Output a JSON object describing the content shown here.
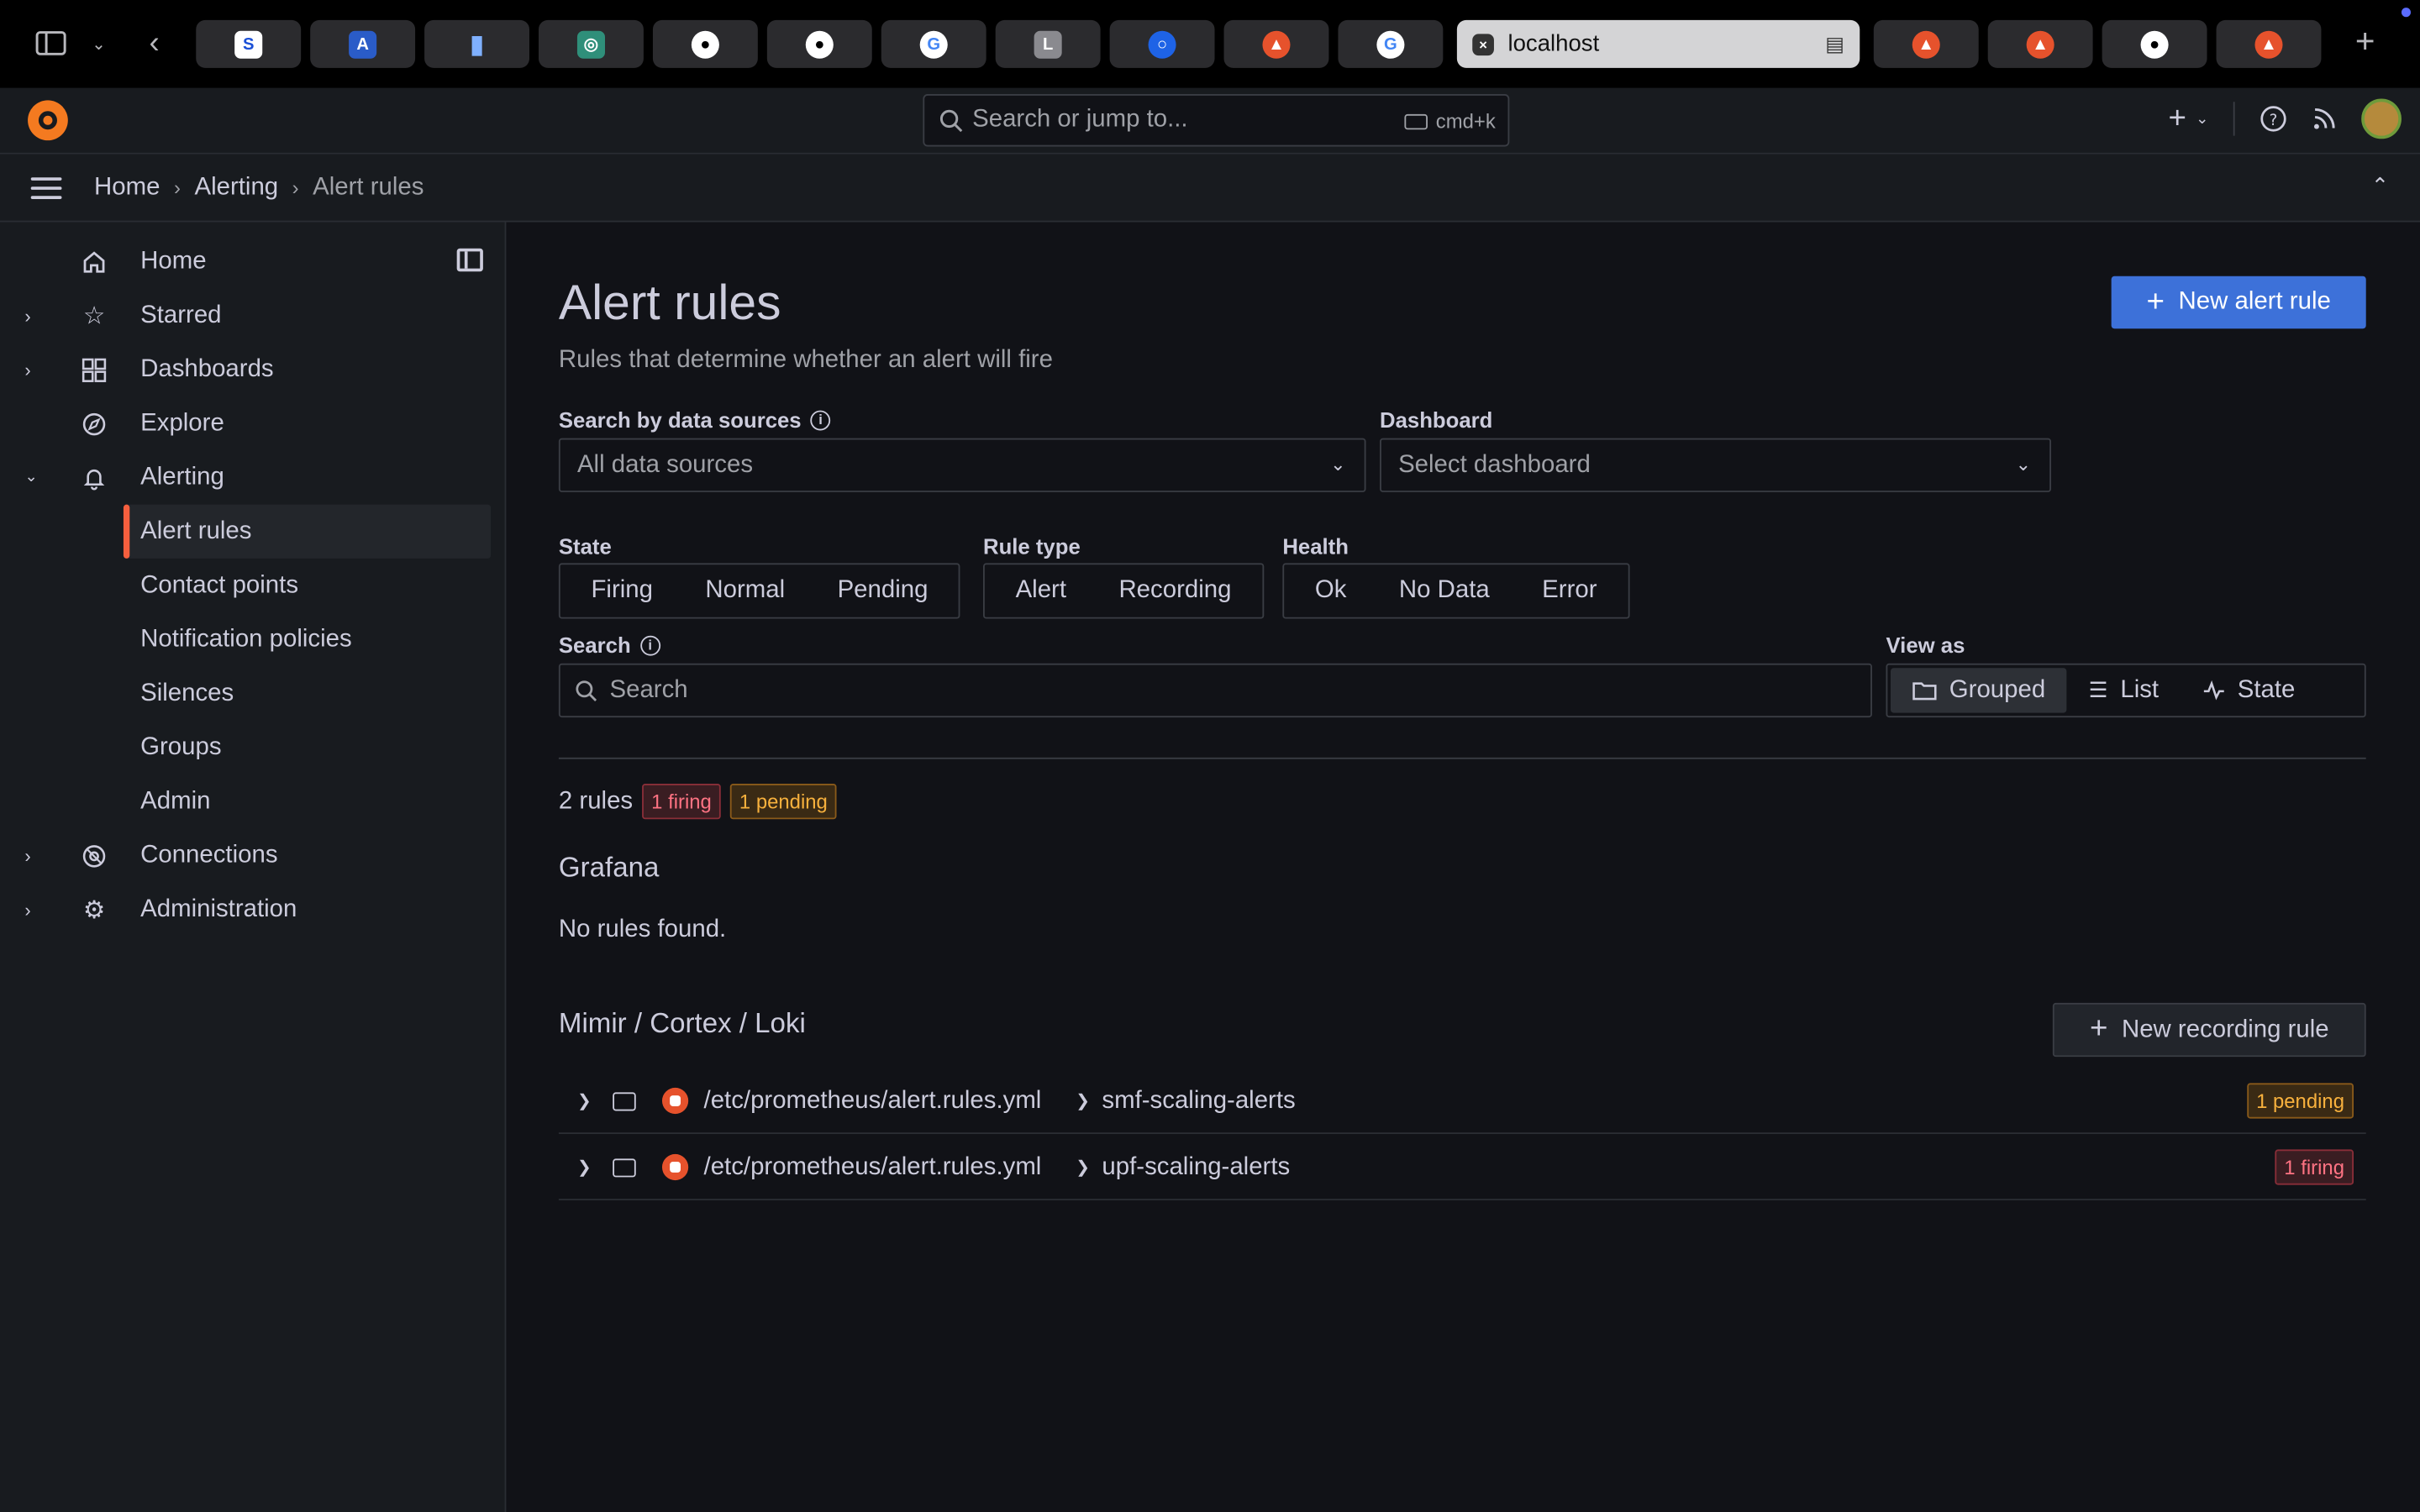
{
  "browser": {
    "active_tab_title": "localhost",
    "tab_favicons": [
      "ms-tab-icon",
      "as-tab-icon",
      "chart-tab-icon",
      "box-tab-icon",
      "github-icon",
      "github-icon",
      "google-icon",
      "l-tab-icon",
      "circle-tab-icon",
      "prometheus-icon",
      "google-icon",
      "localhost-favicon",
      "prometheus-icon",
      "prometheus-icon",
      "github-icon",
      "prometheus-icon"
    ],
    "favicon_letters": {
      "l": "L"
    }
  },
  "topbar": {
    "search_placeholder": "Search or jump to...",
    "shortcut": "cmd+k"
  },
  "breadcrumb": [
    "Home",
    "Alerting",
    "Alert rules"
  ],
  "sidebar": {
    "items": [
      {
        "label": "Home",
        "icon": "home-icon",
        "expandable": false
      },
      {
        "label": "Starred",
        "icon": "star-icon",
        "expandable": true
      },
      {
        "label": "Dashboards",
        "icon": "dashboards-icon",
        "expandable": true
      },
      {
        "label": "Explore",
        "icon": "compass-icon",
        "expandable": false
      },
      {
        "label": "Alerting",
        "icon": "bell-icon",
        "expandable": true,
        "expanded": true
      },
      {
        "label": "Connections",
        "icon": "connections-icon",
        "expandable": true
      },
      {
        "label": "Administration",
        "icon": "gear-icon",
        "expandable": true
      }
    ],
    "alerting_children": [
      "Alert rules",
      "Contact points",
      "Notification policies",
      "Silences",
      "Groups",
      "Admin"
    ],
    "active_child": "Alert rules"
  },
  "page": {
    "title": "Alert rules",
    "subtitle": "Rules that determine whether an alert will fire",
    "new_alert_rule": "New alert rule",
    "filters": {
      "datasource_label": "Search by data sources",
      "datasource_value": "All data sources",
      "dashboard_label": "Dashboard",
      "dashboard_value": "Select dashboard",
      "state_label": "State",
      "state_options": [
        "Firing",
        "Normal",
        "Pending"
      ],
      "rule_type_label": "Rule type",
      "rule_type_options": [
        "Alert",
        "Recording"
      ],
      "health_label": "Health",
      "health_options": [
        "Ok",
        "No Data",
        "Error"
      ],
      "search_label": "Search",
      "search_placeholder": "Search",
      "view_as_label": "View as",
      "view_options": [
        "Grouped",
        "List",
        "State"
      ],
      "view_selected": "Grouped"
    },
    "summary": {
      "rules": "2 rules",
      "firing": "1 firing",
      "pending": "1 pending"
    },
    "grafana_section": {
      "title": "Grafana",
      "empty": "No rules found."
    },
    "external_section": {
      "title": "Mimir / Cortex / Loki",
      "new_recording_rule": "New recording rule",
      "rows": [
        {
          "namespace": "/etc/prometheus/alert.rules.yml",
          "group": "smf-scaling-alerts",
          "badge": "1 pending",
          "badge_type": "pending"
        },
        {
          "namespace": "/etc/prometheus/alert.rules.yml",
          "group": "upf-scaling-alerts",
          "badge": "1 firing",
          "badge_type": "firing"
        }
      ]
    }
  },
  "colors": {
    "primary": "#3d71d9",
    "active_accent": "#f55f3e",
    "firing": "#ff7383",
    "pending": "#f8b13d",
    "background": "#111217",
    "panel": "#181b1f"
  }
}
